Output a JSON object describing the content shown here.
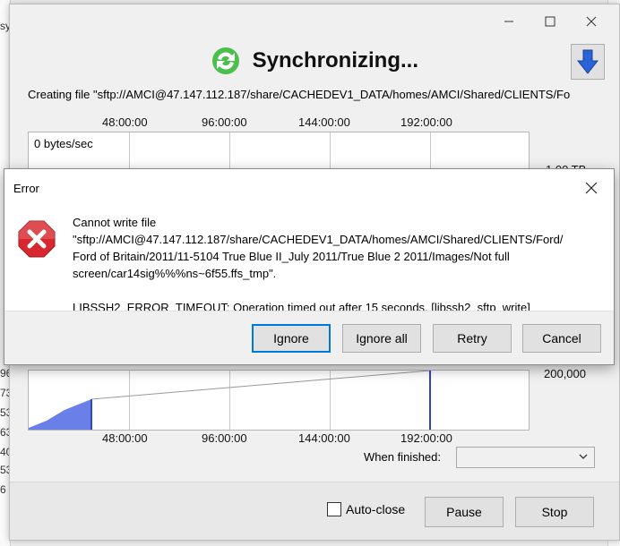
{
  "background": {
    "left_numbers": [
      "sy",
      "96",
      "73",
      "53",
      "63",
      "40",
      "53",
      "6"
    ]
  },
  "sync_window": {
    "title": "Synchronizing...",
    "creating_file": "Creating file \"sftp://AMCI@47.147.112.187/share/CACHEDEV1_DATA/homes/AMCI/Shared/CLIENTS/Fo",
    "top_axis_ticks": [
      "48:00:00",
      "96:00:00",
      "144:00:00",
      "192:00:00"
    ],
    "bottom_axis_ticks": [
      "48:00:00",
      "96:00:00",
      "144:00:00",
      "192:00:00"
    ],
    "rate_label": "0 bytes/sec",
    "right_value_top": "1.00 TB",
    "right_value_bottom": "200,000",
    "when_finished_label": "When finished:",
    "when_finished_value": "",
    "auto_close_label": "Auto-close",
    "pause_label": "Pause",
    "stop_label": "Stop"
  },
  "error_dialog": {
    "title": "Error",
    "message_lines": [
      "Cannot write file",
      "\"sftp://AMCI@47.147.112.187/share/CACHEDEV1_DATA/homes/AMCI/Shared/CLIENTS/Ford/",
      "Ford of Britain/2011/11-5104 True Blue II_July 2011/True Blue 2 2011/Images/Not full",
      "screen/car14sig%%%ns~6f55.ffs_tmp\"."
    ],
    "detail": "LIBSSH2_ERROR_TIMEOUT: Operation timed out after 15 seconds. [libssh2_sftp_write]",
    "buttons": {
      "ignore": "Ignore",
      "ignore_all": "Ignore all",
      "retry": "Retry",
      "cancel": "Cancel"
    }
  },
  "colors": {
    "accent_blue": "#0078d7",
    "graph_fill": "#6b7fe8",
    "error_red": "#d8272e",
    "sync_green": "#3aa83a"
  }
}
